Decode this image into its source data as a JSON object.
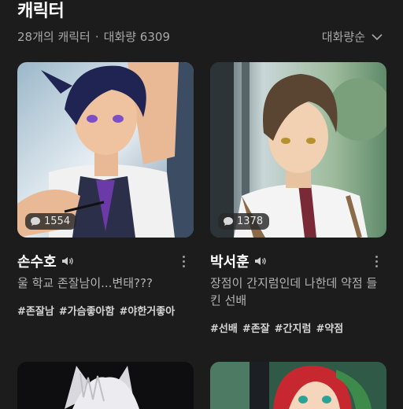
{
  "header": {
    "title": "캐릭터",
    "count_text": "28개의 캐릭터",
    "separator": "·",
    "chats_text": "대화량 6309",
    "sort_label": "대화량순"
  },
  "cards": [
    {
      "name": "손수호",
      "chats": "1554",
      "description": "울 학교 존잘남이...변태???",
      "tags": [
        "#존잘남",
        "#가슴좋아함",
        "#야한거좋아"
      ]
    },
    {
      "name": "박서훈",
      "chats": "1378",
      "description": "장점이 간지럼인데 나한데 약점 들킨 선배",
      "tags": [
        "#선배",
        "#존잘",
        "#간지럼",
        "#약점"
      ]
    }
  ],
  "colors": {
    "background": "#1c1c1c",
    "title": "#ffffff",
    "muted": "#a8a8a8"
  }
}
